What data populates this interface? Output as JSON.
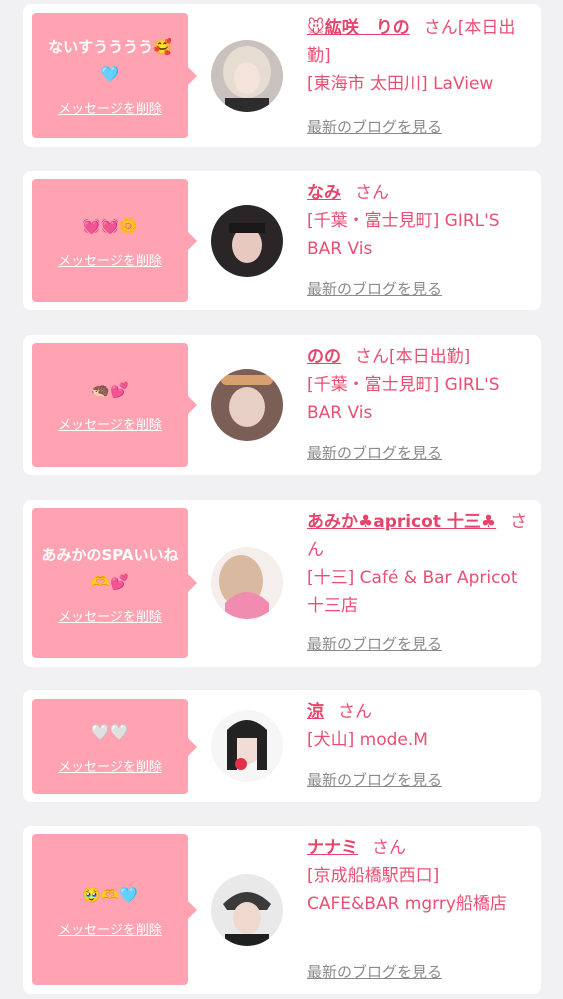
{
  "delete_label": "メッセージを削除",
  "blog_label": "最新のブログを見る",
  "cards": [
    {
      "message": "ないすうううう🥰🩵",
      "name": "🐭紘咲　りの",
      "suffix": "さん[本日出勤]",
      "location": "[東海市 太田川] LaView"
    },
    {
      "message": "💓💓🌼",
      "name": "なみ",
      "suffix": "さん",
      "location": "[千葉・富士見町] GIRL'S BAR Vis"
    },
    {
      "message": "🦔💕",
      "name": "のの",
      "suffix": "さん[本日出勤]",
      "location": "[千葉・富士見町] GIRL'S BAR Vis"
    },
    {
      "message": "あみかのSPAいいね🫶💕",
      "name": "あみか♣apricot 十三♣",
      "suffix": "さん",
      "location": "[十三] Café & Bar Apricot 十三店"
    },
    {
      "message": "🤍🤍",
      "name": "涼",
      "suffix": "さん",
      "location": "[犬山] mode.M"
    },
    {
      "message": "🥹🫶🩵",
      "name": "ナナミ",
      "suffix": "さん",
      "location": "[京成船橋駅西口] CAFE&BAR mgrry船橋店"
    }
  ]
}
